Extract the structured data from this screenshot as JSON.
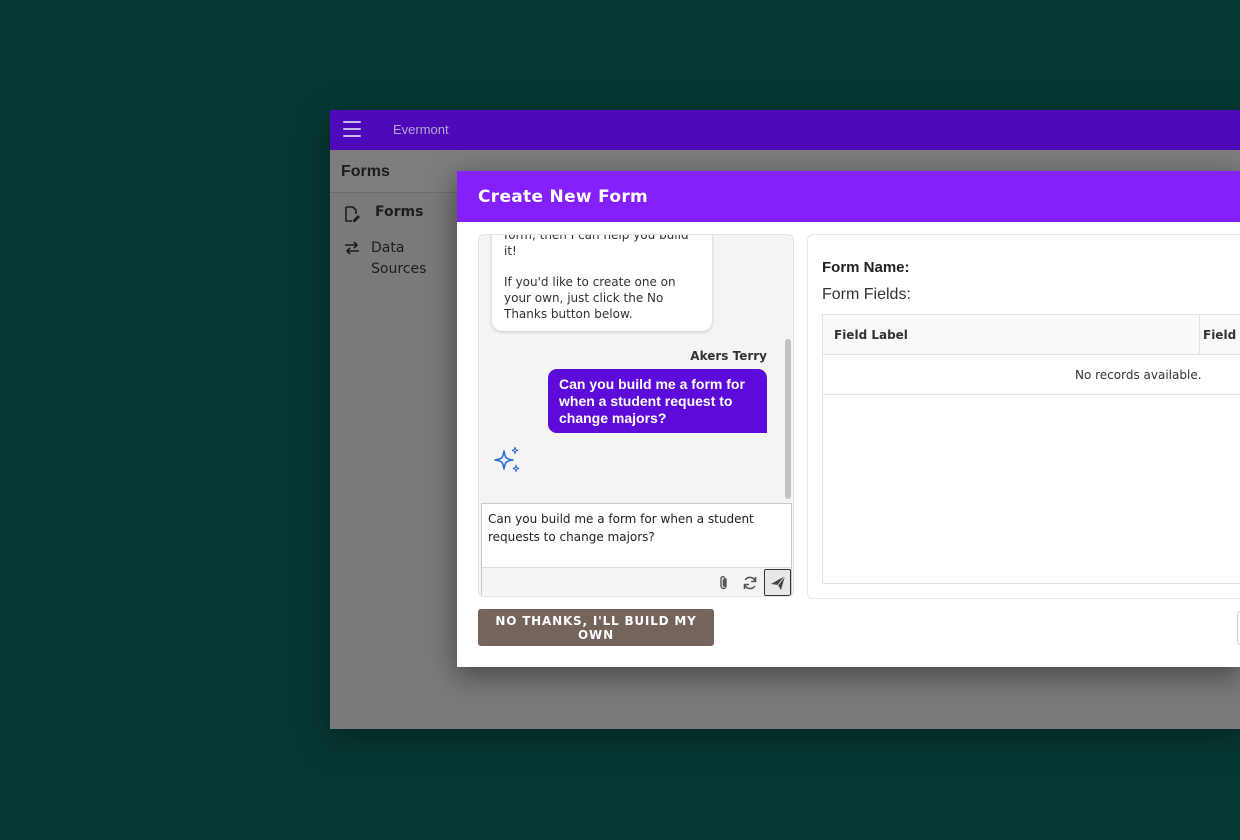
{
  "app": {
    "name": "Evermont"
  },
  "page": {
    "title": "Forms"
  },
  "nav": {
    "items": [
      {
        "label": "Forms",
        "icon": "form-edit-icon",
        "active": true
      },
      {
        "label": "Data Sources",
        "icon": "swap-arrows-icon",
        "active": false
      }
    ]
  },
  "modal": {
    "title": "Create New Form",
    "chat": {
      "bot_message_lines": [
        "form, then I can help you build it!",
        "If you'd like to create one on your own, just click the No Thanks button below."
      ],
      "user_name": "Akers Terry",
      "user_message": "Can you build me a form for when a student request to change majors?",
      "assistant_icon": "sparkle-icon",
      "input_value": "Can you build me a form for when a student requests to change majors?",
      "toolbar_icons": [
        "paperclip-icon",
        "refresh-icon",
        "send-icon"
      ]
    },
    "form": {
      "name_label": "Form Name:",
      "fields_label": "Form Fields:",
      "table": {
        "columns": [
          "Field Label",
          "Field"
        ],
        "empty_text": "No records available."
      }
    },
    "no_thanks_label": "NO THANKS, I'LL BUILD MY OWN"
  },
  "colors": {
    "background": "#063833",
    "topbar": "#4e0ab8",
    "modal_header": "#8320fc",
    "user_bubble": "#5d0bd9",
    "no_thanks_button": "#74645b",
    "sparkle": "#2b6fd6"
  }
}
